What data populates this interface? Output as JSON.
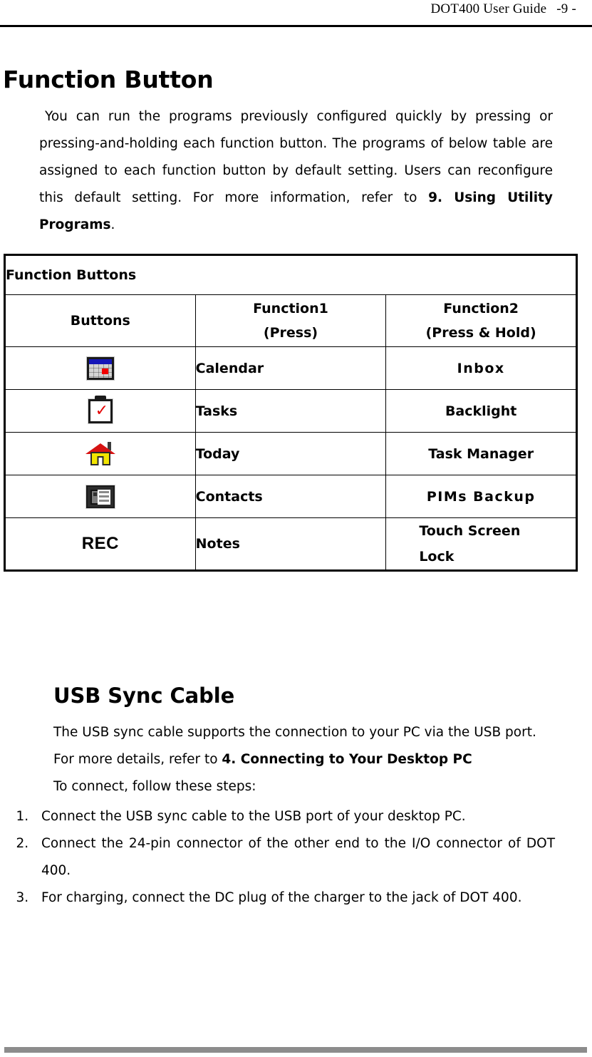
{
  "header": {
    "document_title": "DOT400 User Guide",
    "page_number": "-9 -"
  },
  "section1": {
    "title": "Function Button",
    "intro_plain_1": "You can run the programs previously configured quickly by pressing or pressing-and-holding each function button. The programs of below table are assigned to each function button by default setting. Users can reconfigure this default setting. For more information, refer to ",
    "intro_bold": "9. Using Utility Programs",
    "intro_plain_2": "."
  },
  "table": {
    "caption": "Function Buttons",
    "columns": {
      "buttons": "Buttons",
      "function1_line1": "Function1",
      "function1_line2": "(Press)",
      "function2_line1": "Function2",
      "function2_line2": "(Press & Hold)"
    },
    "rows": [
      {
        "icon": "calendar-icon",
        "button_label": "",
        "function1": "Calendar",
        "function2": "Inbox",
        "function2_line2": ""
      },
      {
        "icon": "clipboard-check-icon",
        "button_label": "",
        "function1": "Tasks",
        "function2": "Backlight",
        "function2_line2": ""
      },
      {
        "icon": "home-icon",
        "button_label": "",
        "function1": "Today",
        "function2": "Task Manager",
        "function2_line2": ""
      },
      {
        "icon": "contacts-card-icon",
        "button_label": "",
        "function1": "Contacts",
        "function2": "PIMs Backup",
        "function2_line2": ""
      },
      {
        "icon": "rec-text-button",
        "button_label": "REC",
        "function1": "Notes",
        "function2": "Touch Screen",
        "function2_line2": "Lock"
      }
    ]
  },
  "section2": {
    "title": "USB Sync Cable",
    "paragraph": "The USB sync cable supports the connection to your PC via the USB port.",
    "refer_plain": "For more details, refer to ",
    "refer_bold": "4. Connecting to Your Desktop PC",
    "steps_intro": "To connect, follow these steps:",
    "steps": [
      "Connect the USB sync cable to the USB port of your desktop PC.",
      "Connect the 24-pin connector of the other end to the I/O connector of DOT 400.",
      " For charging, connect the DC plug of the charger to the jack of DOT 400."
    ]
  },
  "colors": {
    "text": "#000000",
    "footer_bar": "#8c8c8c",
    "calendar_bar": "#1516b8",
    "calendar_day": "#f10000",
    "check_red": "#e40000",
    "roof_red": "#d61212",
    "house_yellow": "#f2e500"
  }
}
